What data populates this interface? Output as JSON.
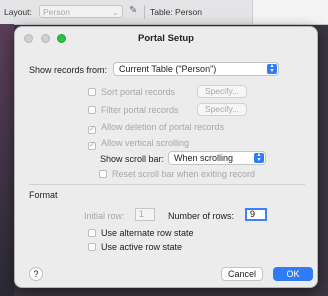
{
  "toolbar": {
    "layout_label": "Layout:",
    "layout_value": "Person",
    "table_label": "Table: Person"
  },
  "dialog": {
    "title": "Portal Setup",
    "show_records_label": "Show records from:",
    "show_records_value": "Current Table (\"Person\")",
    "sort_label": "Sort portal records",
    "sort_specify": "Specify...",
    "filter_label": "Filter portal records",
    "filter_specify": "Specify...",
    "allow_delete_label": "Allow deletion of portal records",
    "allow_scroll_label": "Allow vertical scrolling",
    "scrollbar_label": "Show scroll bar:",
    "scrollbar_value": "When scrolling",
    "reset_scroll_label": "Reset scroll bar when exiting record",
    "format_heading": "Format",
    "initial_row_label": "Initial row:",
    "initial_row_value": "1",
    "num_rows_label": "Number of rows:",
    "num_rows_value": "9",
    "alt_row_label": "Use alternate row state",
    "active_row_label": "Use active row state",
    "help_label": "?",
    "cancel_label": "Cancel",
    "ok_label": "OK"
  },
  "icons": {
    "pencil": "pencil-icon",
    "chevron": "chevron-up-down-icon",
    "check": "checkmark-icon"
  },
  "colors": {
    "accent": "#2f7cf6",
    "window_bg": "#ececec",
    "disabled_text": "#a7a7a9"
  }
}
